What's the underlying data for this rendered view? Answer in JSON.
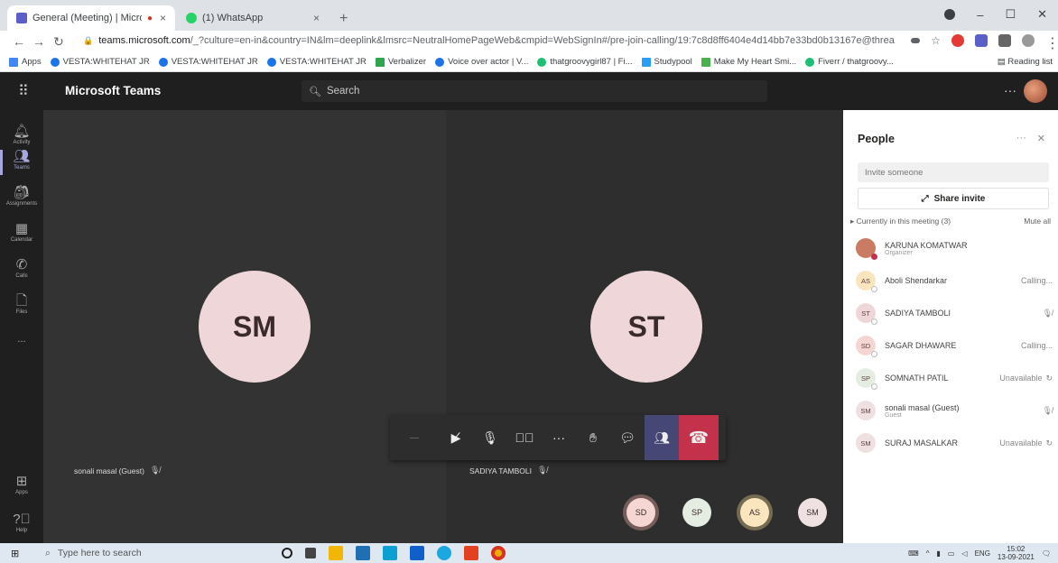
{
  "browser": {
    "tabs": [
      {
        "title": "General (Meeting) | Microso",
        "active": true
      },
      {
        "title": "(1) WhatsApp",
        "active": false
      }
    ],
    "url_host": "teams.microsoft.com",
    "url_path": "/_?culture=en-in&country=IN&lm=deeplink&lmsrc=NeutralHomePageWeb&cmpid=WebSignIn#/pre-join-calling/19:7c8d8ff6404e4d14bb7e33bd0b13167e@threa...",
    "bookmarks": [
      "Apps",
      "VESTA:WHITEHAT JR",
      "VESTA:WHITEHAT JR",
      "VESTA:WHITEHAT JR",
      "Verbalizer",
      "Voice over actor | V...",
      "thatgroovygirl87 | Fi...",
      "Studypool",
      "Make My Heart Smi...",
      "Fiverr / thatgroovy..."
    ],
    "reading_list": "Reading list"
  },
  "teams": {
    "brand": "Microsoft Teams",
    "search_placeholder": "Search",
    "rail": [
      {
        "label": "Activity",
        "icon": "bell-icon"
      },
      {
        "label": "Teams",
        "icon": "teams-icon"
      },
      {
        "label": "Assignments",
        "icon": "assignments-icon"
      },
      {
        "label": "Calendar",
        "icon": "calendar-icon"
      },
      {
        "label": "Calls",
        "icon": "phone-icon"
      },
      {
        "label": "Files",
        "icon": "file-icon"
      },
      {
        "label": "...",
        "icon": "more-icon"
      }
    ],
    "rail_bottom": [
      {
        "label": "Apps",
        "icon": "apps-icon"
      },
      {
        "label": "Help",
        "icon": "help-icon"
      }
    ]
  },
  "stage": {
    "tiles": [
      {
        "initials": "SM",
        "name": "sonali masal (Guest)"
      },
      {
        "initials": "ST",
        "name": "SADIYA TAMBOLI"
      }
    ],
    "mini_avatars": [
      "SD",
      "SP",
      "AS",
      "SM"
    ]
  },
  "people_panel": {
    "title": "People",
    "invite_placeholder": "Invite someone",
    "share_label": "Share invite",
    "section_label": "Currently in this meeting (3)",
    "mute_all": "Mute all",
    "people": [
      {
        "initials": "",
        "name": "KARUNA KOMATWAR",
        "sub": "Organizer",
        "status": "",
        "color": "#c97b64"
      },
      {
        "initials": "AS",
        "name": "Aboli Shendarkar",
        "sub": "",
        "status": "Calling...",
        "color": "#fbe5bf"
      },
      {
        "initials": "ST",
        "name": "SADIYA TAMBOLI",
        "sub": "",
        "status": "",
        "color": "#efd7d9"
      },
      {
        "initials": "SD",
        "name": "SAGAR DHAWARE",
        "sub": "",
        "status": "Calling...",
        "color": "#f6d6d2"
      },
      {
        "initials": "SP",
        "name": "SOMNATH PATIL",
        "sub": "",
        "status": "Unavailable",
        "color": "#e5ede2"
      },
      {
        "initials": "SM",
        "name": "sonali masal (Guest)",
        "sub": "Guest",
        "status": "",
        "color": "#efe0e1"
      },
      {
        "initials": "SM",
        "name": "SURAJ MASALKAR",
        "sub": "",
        "status": "Unavailable",
        "color": "#efe0e1"
      }
    ]
  },
  "taskbar": {
    "search_placeholder": "Type here to search",
    "lang": "ENG",
    "time": "15:02",
    "date": "13-09-2021"
  }
}
